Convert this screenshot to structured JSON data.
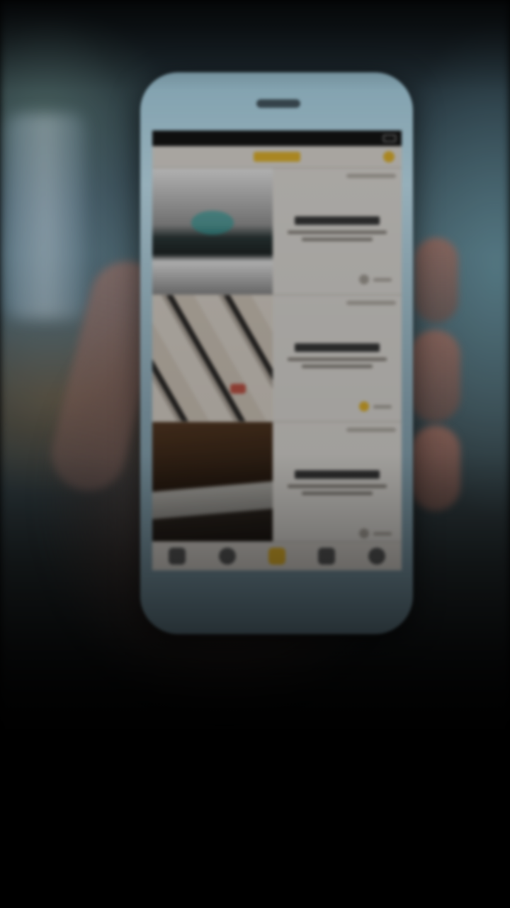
{
  "scene": {
    "description_icons": [
      "phone-mockup",
      "hand",
      "glass"
    ]
  },
  "app": {
    "status_bar": {
      "carrier": "",
      "time": "",
      "battery": ""
    },
    "header": {
      "logo": "brand-logo-icon",
      "action_icon": "profile-icon"
    },
    "cards": [
      {
        "image": "sneaker-photo",
        "title": "",
        "stat_icon": "heart-icon",
        "stat_active": false
      },
      {
        "image": "rolls-photo",
        "title": "",
        "stat_icon": "heart-icon",
        "stat_active": true
      },
      {
        "image": "desk-photo",
        "title": "",
        "stat_icon": "heart-icon",
        "stat_active": false
      }
    ],
    "tabbar": {
      "items": [
        {
          "icon": "home-icon",
          "active": false
        },
        {
          "icon": "search-icon",
          "active": false
        },
        {
          "icon": "feed-icon",
          "active": true
        },
        {
          "icon": "bag-icon",
          "active": false
        },
        {
          "icon": "user-icon",
          "active": false
        }
      ]
    }
  },
  "colors": {
    "accent": "#e8b82e",
    "background": "#000000"
  }
}
